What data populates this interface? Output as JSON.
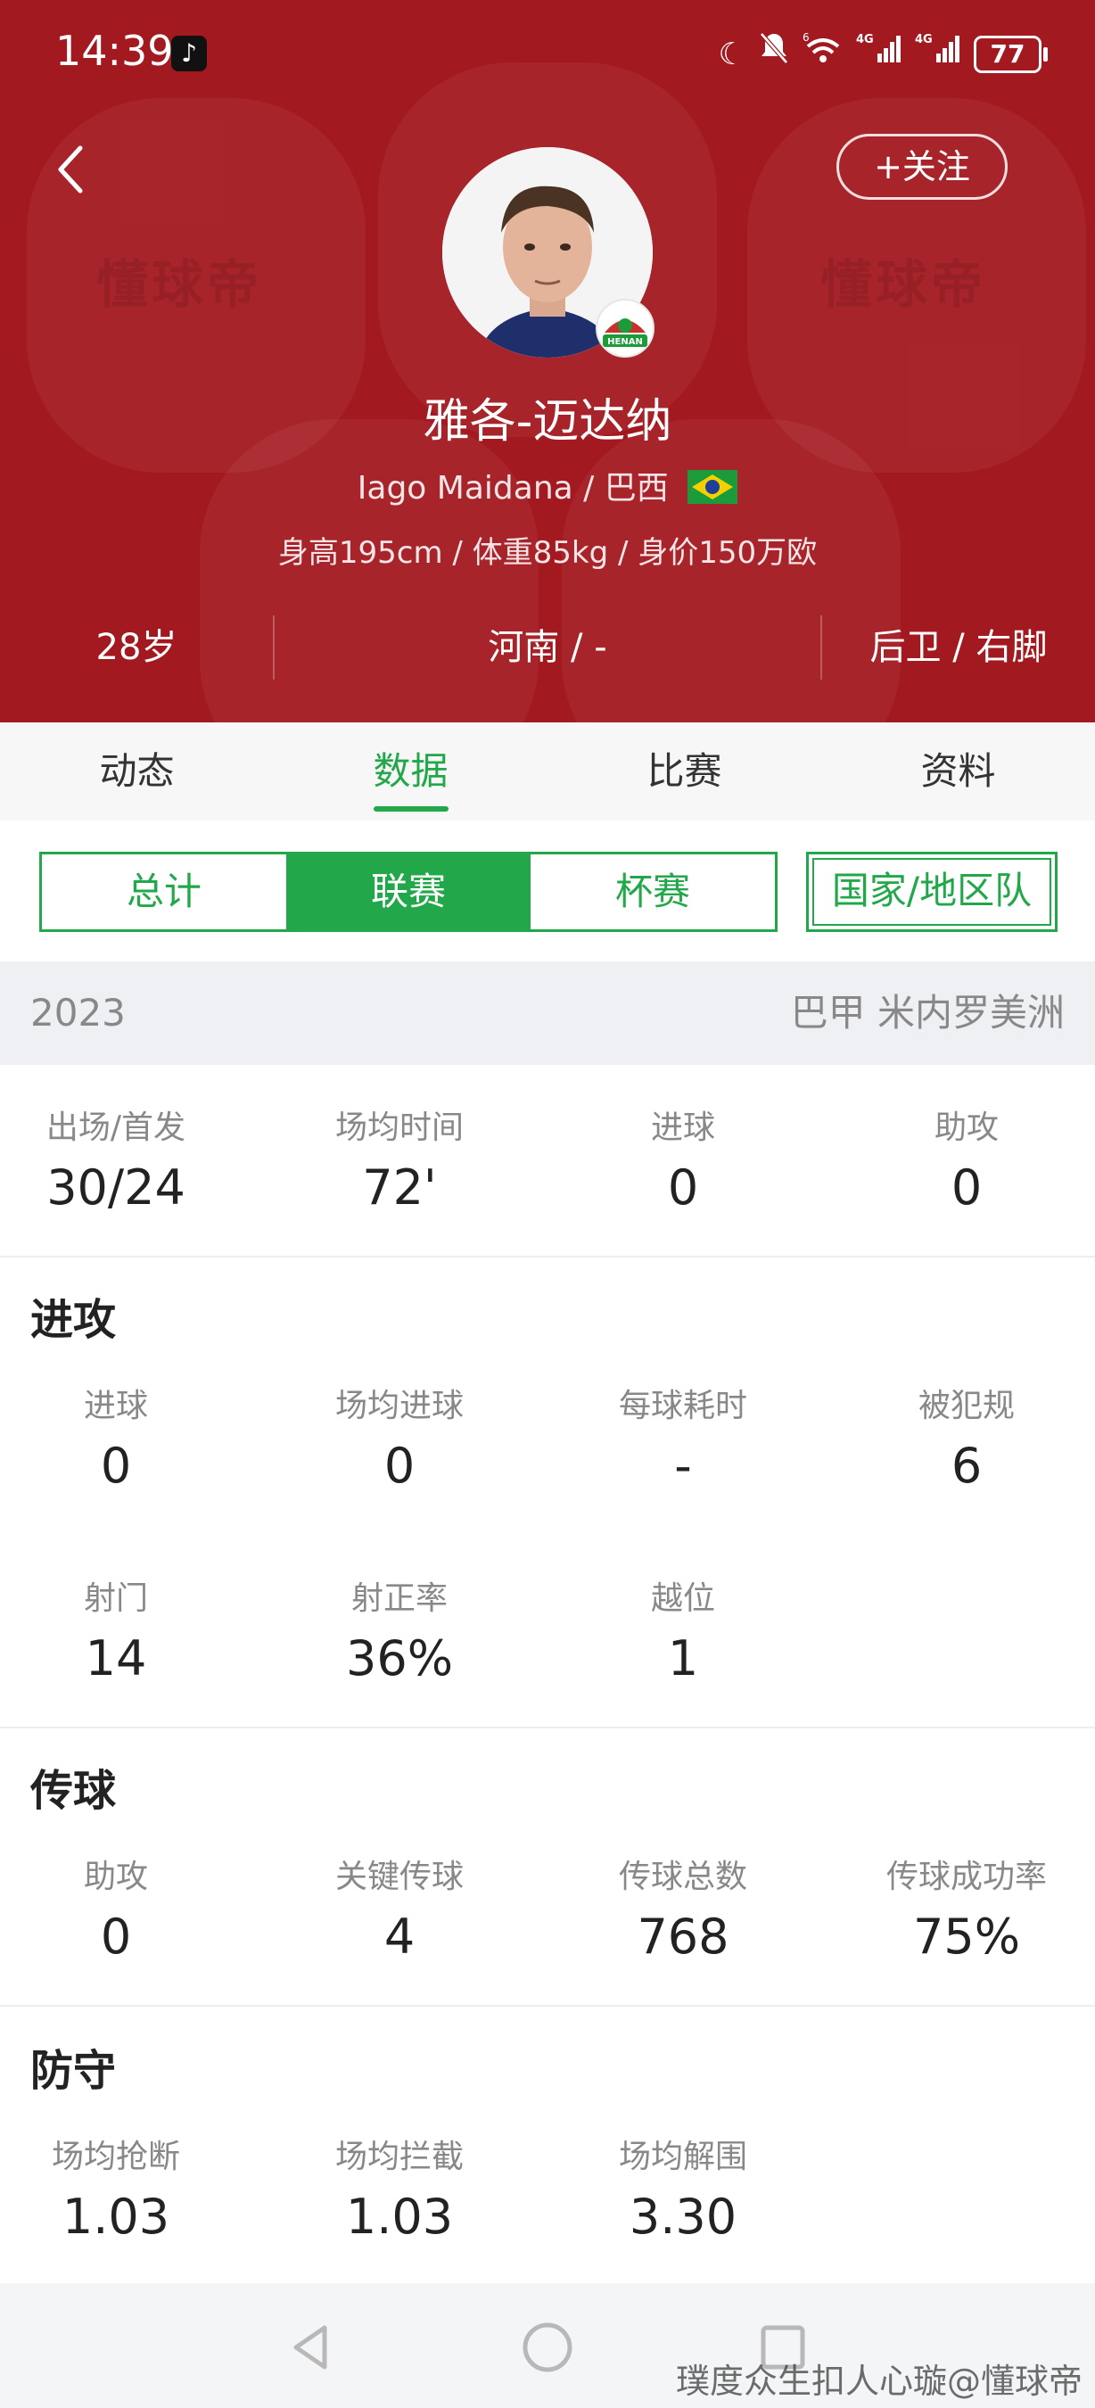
{
  "status_bar": {
    "time": "14:39",
    "network_labels": [
      "4G",
      "4G"
    ],
    "wifi_badge": "6",
    "battery": "77"
  },
  "header": {
    "watermark": "懂球帝",
    "follow_label": "+关注",
    "player_name": "雅各-迈达纳",
    "latin_name": "Iago Maidana",
    "nationality": "巴西",
    "physical": "身高195cm / 体重85kg / 身价150万欧",
    "club_badge_text": "HENAN",
    "info": {
      "age": "28岁",
      "club": "河南 / -",
      "position": "后卫 / 右脚"
    },
    "colors": {
      "background": "#a31920",
      "accent": "#22a84a"
    }
  },
  "tabs": [
    "动态",
    "数据",
    "比赛",
    "资料"
  ],
  "active_tab": "数据",
  "segments": [
    "总计",
    "联赛",
    "杯赛"
  ],
  "active_segment": "联赛",
  "country_button": "国家/地区队",
  "season": {
    "year": "2023",
    "league": "巴甲 米内罗美洲"
  },
  "summary": [
    {
      "label": "出场/首发",
      "value": "30/24"
    },
    {
      "label": "场均时间",
      "value": "72'"
    },
    {
      "label": "进球",
      "value": "0"
    },
    {
      "label": "助攻",
      "value": "0"
    }
  ],
  "attack": {
    "title": "进攻",
    "stats": [
      {
        "label": "进球",
        "value": "0"
      },
      {
        "label": "场均进球",
        "value": "0"
      },
      {
        "label": "每球耗时",
        "value": "-"
      },
      {
        "label": "被犯规",
        "value": "6"
      },
      {
        "label": "射门",
        "value": "14"
      },
      {
        "label": "射正率",
        "value": "36%"
      },
      {
        "label": "越位",
        "value": "1"
      }
    ]
  },
  "passing": {
    "title": "传球",
    "stats": [
      {
        "label": "助攻",
        "value": "0"
      },
      {
        "label": "关键传球",
        "value": "4"
      },
      {
        "label": "传球总数",
        "value": "768"
      },
      {
        "label": "传球成功率",
        "value": "75%"
      }
    ]
  },
  "defense": {
    "title": "防守",
    "stats": [
      {
        "label": "场均抢断",
        "value": "1.03"
      },
      {
        "label": "场均拦截",
        "value": "1.03"
      },
      {
        "label": "场均解围",
        "value": "3.30"
      }
    ]
  },
  "watermark_footer": "璞度众生扣人心璇@懂球帝"
}
